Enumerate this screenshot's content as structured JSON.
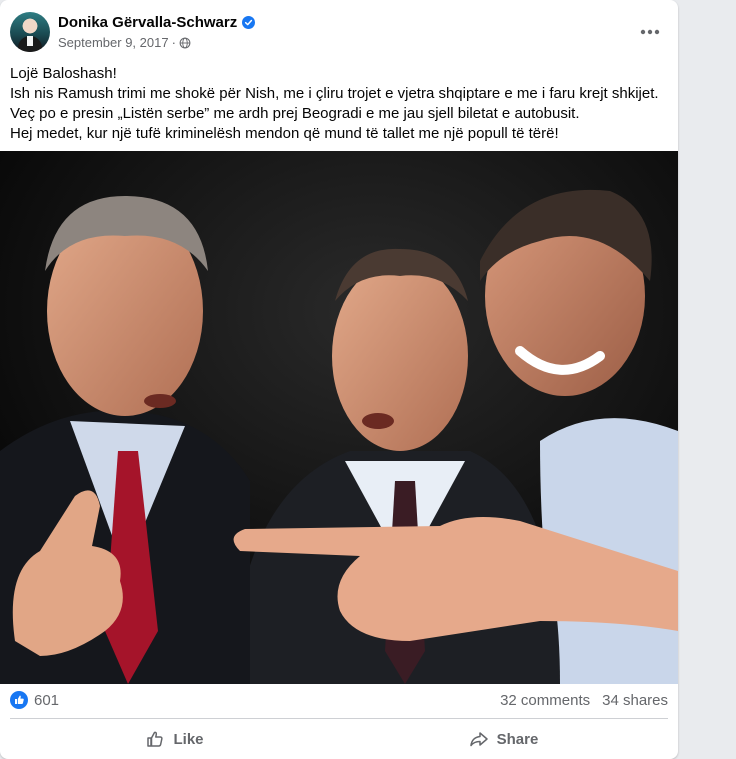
{
  "post": {
    "author": "Donika Gërvalla-Schwarz",
    "date": "September 9, 2017",
    "separator": "·",
    "text_lines": [
      "Lojë Baloshash!",
      "Ish nis Ramush trimi me shokë për Nish, me i çliru trojet e vjetra shqiptare e me i faru krejt shkijet.",
      "Veç po e presin „Listën serbe” me ardh prej Beogradi e me jau sjell biletat e autobusit.",
      "Hej medet, kur një tufë kriminelësh mendon që mund të tallet me një popull të tërë!"
    ]
  },
  "stats": {
    "reactions": "601",
    "comments": "32 comments",
    "shares": "34 shares"
  },
  "actions": {
    "like": "Like",
    "share": "Share"
  },
  "colors": {
    "brand_blue": "#1877f2",
    "secondary_text": "#65676b",
    "divider": "#ced0d4"
  },
  "icons": {
    "verified": "verified-badge-icon",
    "audience": "globe-icon",
    "more": "more-options-icon",
    "like_reaction": "thumbs-up-reaction-icon",
    "like_action": "thumbs-up-outline-icon",
    "share_action": "share-arrow-icon"
  }
}
